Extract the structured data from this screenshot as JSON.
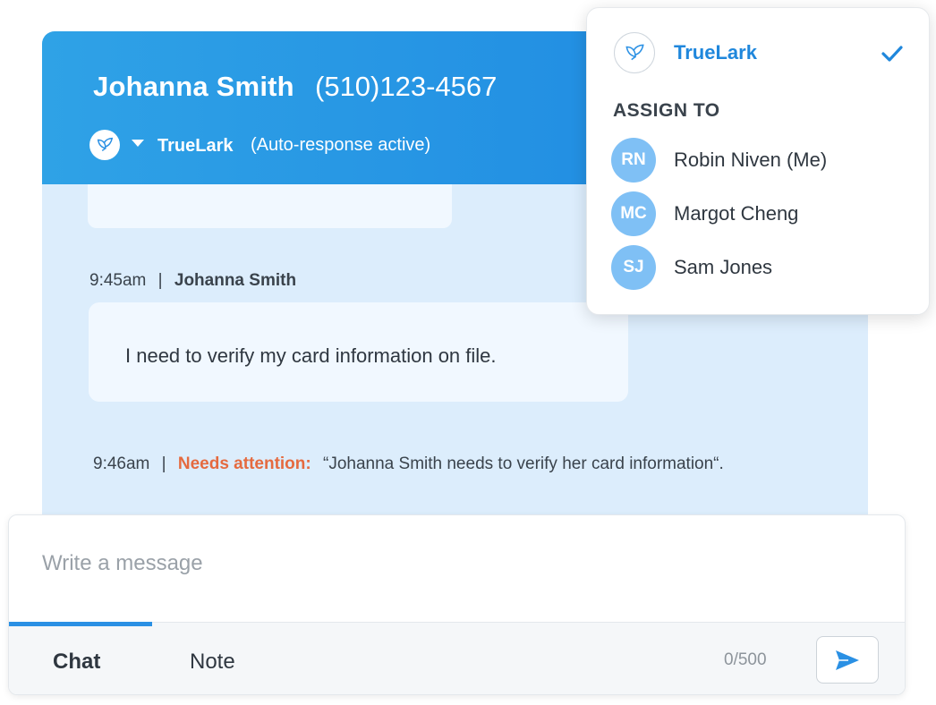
{
  "conversation": {
    "contact_name": "Johanna Smith",
    "contact_phone": "(510)123-4567",
    "agent_name": "TrueLark",
    "agent_status": "(Auto-response active)",
    "messages": [
      {
        "time": "9:45am",
        "separator": "|",
        "sender": "Johanna Smith",
        "text": "I need to verify my card information on file."
      }
    ],
    "alert": {
      "time": "9:46am",
      "separator": "|",
      "label": "Needs attention:",
      "text": "“Johanna Smith needs to verify her card information“."
    }
  },
  "composer": {
    "placeholder": "Write a message",
    "tabs": [
      "Chat",
      "Note"
    ],
    "active_tab": "Chat",
    "char_count": "0/500",
    "accent_color": "#2a90e4"
  },
  "assign_dropdown": {
    "current_agent": "TrueLark",
    "heading": "ASSIGN TO",
    "users": [
      {
        "initials": "RN",
        "name": "Robin Niven (Me)"
      },
      {
        "initials": "MC",
        "name": "Margot Cheng"
      },
      {
        "initials": "SJ",
        "name": "Sam Jones"
      }
    ],
    "accent_color": "#1f87dc",
    "avatar_color": "#7fc0f5"
  },
  "colors": {
    "header_gradient_start": "#2fa2e6",
    "header_gradient_end": "#1c86e1",
    "panel_background": "#dcedfc",
    "alert_color": "#e56a3f"
  }
}
